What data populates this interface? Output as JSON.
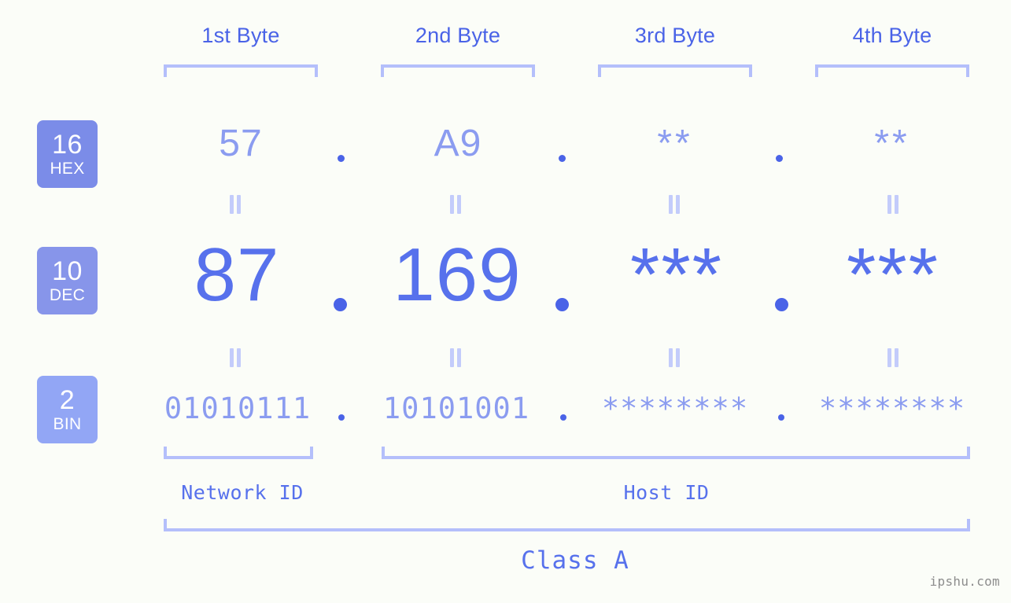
{
  "headers": [
    {
      "label": "1st Byte"
    },
    {
      "label": "2nd Byte"
    },
    {
      "label": "3rd Byte"
    },
    {
      "label": "4th Byte"
    }
  ],
  "bases": [
    {
      "number": "16",
      "abbr": "HEX",
      "color": "#7b8ce8"
    },
    {
      "number": "10",
      "abbr": "DEC",
      "color": "#8795ea"
    },
    {
      "number": "2",
      "abbr": "BIN",
      "color": "#92a6f5"
    }
  ],
  "rows": {
    "hex": {
      "values": [
        "57",
        "A9",
        "**",
        "**"
      ]
    },
    "dec": {
      "values": [
        "87",
        "169",
        "***",
        "***"
      ]
    },
    "bin": {
      "values": [
        "01010111",
        "10101001",
        "********",
        "********"
      ]
    }
  },
  "separators": {
    "hex_dot": ".",
    "dec_dot": ".",
    "bin_dot": "."
  },
  "equals_symbol": "=",
  "footer": {
    "network_id": "Network ID",
    "host_id": "Host ID",
    "class_label": "Class A",
    "watermark": "ipshu.com"
  },
  "colors": {
    "background": "#fbfdf8",
    "accent_strong": "#4a63e7",
    "accent_mid": "#5771ec",
    "accent_light": "#8b9cf0",
    "bracket": "#b4bffb",
    "equals": "#c3ccfb",
    "watermark": "#8d8d8d"
  }
}
